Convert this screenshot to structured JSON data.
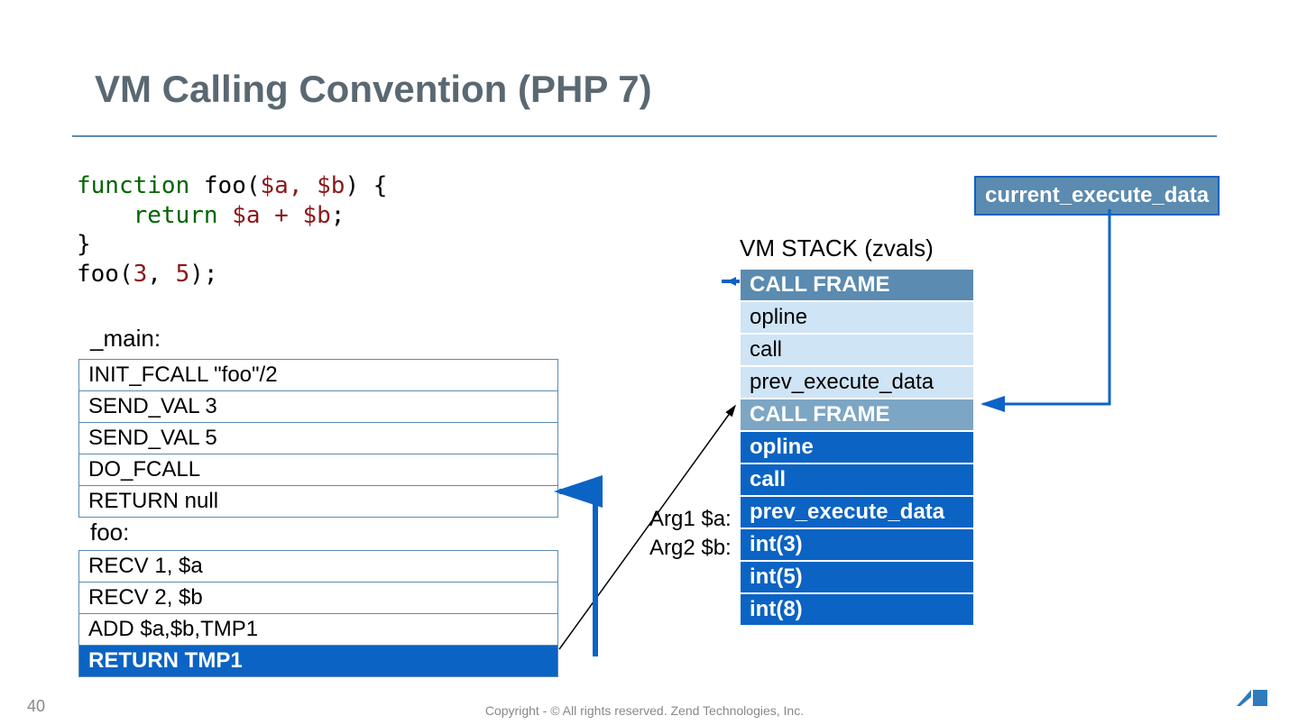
{
  "title": "VM Calling Convention (PHP 7)",
  "code": {
    "l1a": "function",
    "l1b": " foo",
    "l1c": "(",
    "l1d": "$a, $b",
    "l1e": ") {",
    "l2a": "    return ",
    "l2b": "$a + $b",
    "l2c": ";",
    "l3": "}",
    "l4a": "foo(",
    "l4b": "3",
    "l4c": ", ",
    "l4d": "5",
    "l4e": ");"
  },
  "main_label": "_main:",
  "main_ops": [
    "INIT_FCALL  \"foo\"/2",
    "SEND_VAL 3",
    "SEND_VAL 5",
    "DO_FCALL",
    "RETURN null"
  ],
  "foo_label": "foo:",
  "foo_ops": [
    {
      "t": "RECV 1, $a",
      "hl": false
    },
    {
      "t": "RECV 2, $b",
      "hl": false
    },
    {
      "t": "ADD $a,$b,TMP1",
      "hl": false
    },
    {
      "t": "RETURN TMP1",
      "hl": true
    }
  ],
  "stack_title": "VM STACK (zvals)",
  "stack": [
    {
      "t": "CALL FRAME",
      "cls": "hdr1"
    },
    {
      "t": "opline",
      "cls": "light"
    },
    {
      "t": "call",
      "cls": "light"
    },
    {
      "t": "prev_execute_data",
      "cls": "light"
    },
    {
      "t": "CALL FRAME",
      "cls": "hdr2"
    },
    {
      "t": "opline",
      "cls": "dark"
    },
    {
      "t": "call",
      "cls": "dark"
    },
    {
      "t": "prev_execute_data",
      "cls": "dark"
    },
    {
      "t": "int(3)",
      "cls": "dark"
    },
    {
      "t": "int(5)",
      "cls": "dark"
    },
    {
      "t": "int(8)",
      "cls": "dark"
    }
  ],
  "args": {
    "a": "Arg1 $a:",
    "b": "Arg2 $b:"
  },
  "ced": "current_execute_data",
  "pagenum": "40",
  "footer": "Copyright - © All rights reserved. Zend Technologies, Inc."
}
